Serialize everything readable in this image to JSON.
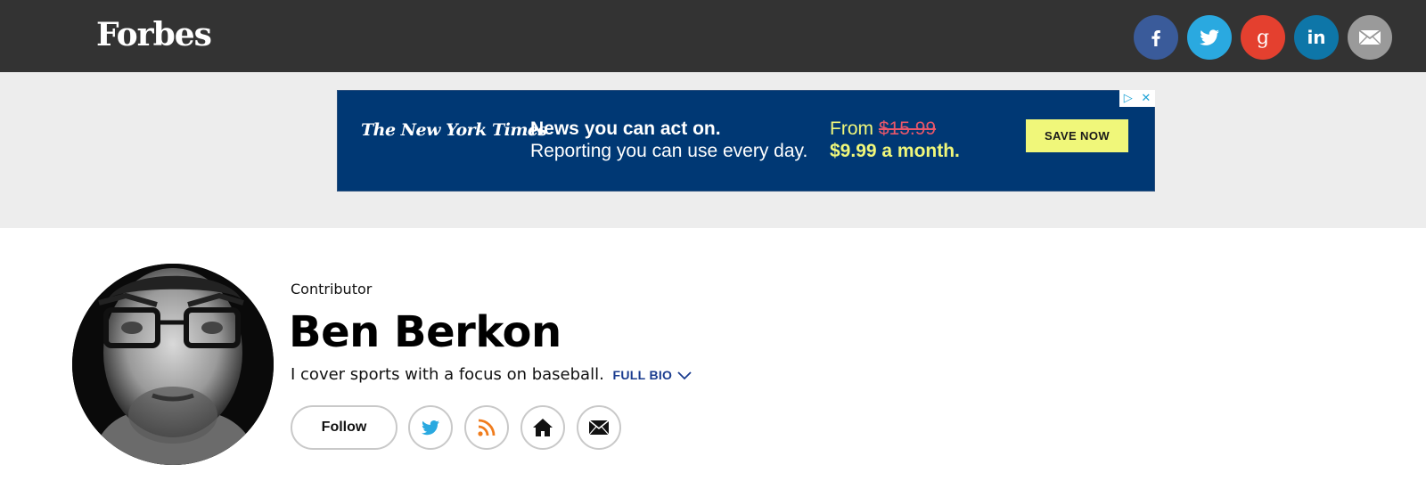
{
  "header": {
    "logo": "Forbes",
    "share": [
      {
        "icon": "facebook-icon",
        "color": "#3a5b9a"
      },
      {
        "icon": "twitter-icon",
        "color": "#2aa9e0"
      },
      {
        "icon": "google-plus-icon",
        "color": "#e4402f"
      },
      {
        "icon": "linkedin-icon",
        "color": "#0e76a8"
      },
      {
        "icon": "email-icon",
        "color": "#9a9a9a"
      }
    ]
  },
  "ad": {
    "brand": "The New York Times",
    "headline": "News you can act on.",
    "subline": "Reporting you can use every day.",
    "from_label": "From",
    "old_price": "$15.99",
    "new_price": "$9.99 a month.",
    "cta": "SAVE NOW",
    "bg_color": "#003874",
    "accent_color": "#f0f77a"
  },
  "profile": {
    "role": "Contributor",
    "name": "Ben Berkon",
    "bio": "I cover sports with a focus on baseball.",
    "full_bio_label": "FULL BIO",
    "follow_label": "Follow",
    "social": [
      "twitter-icon",
      "rss-icon",
      "home-icon",
      "email-icon"
    ]
  }
}
